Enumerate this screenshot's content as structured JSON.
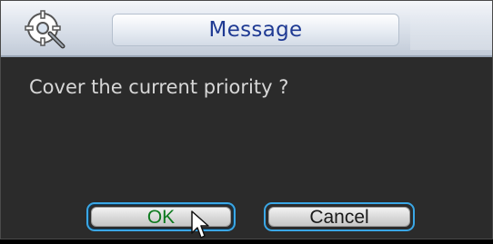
{
  "dialog": {
    "title": "Message",
    "message": "Cover the current priority ?",
    "buttons": {
      "ok_label": "OK",
      "cancel_label": "Cancel"
    }
  },
  "icons": {
    "title_icon": "gear-wrench-icon",
    "cursor": "mouse-pointer-icon"
  },
  "colors": {
    "title_text": "#1f3a93",
    "message_text": "#d7d7d7",
    "ok_text": "#0e7a1f",
    "button_focus_border": "#3aa7e6",
    "dialog_background": "#2b2b2b"
  }
}
